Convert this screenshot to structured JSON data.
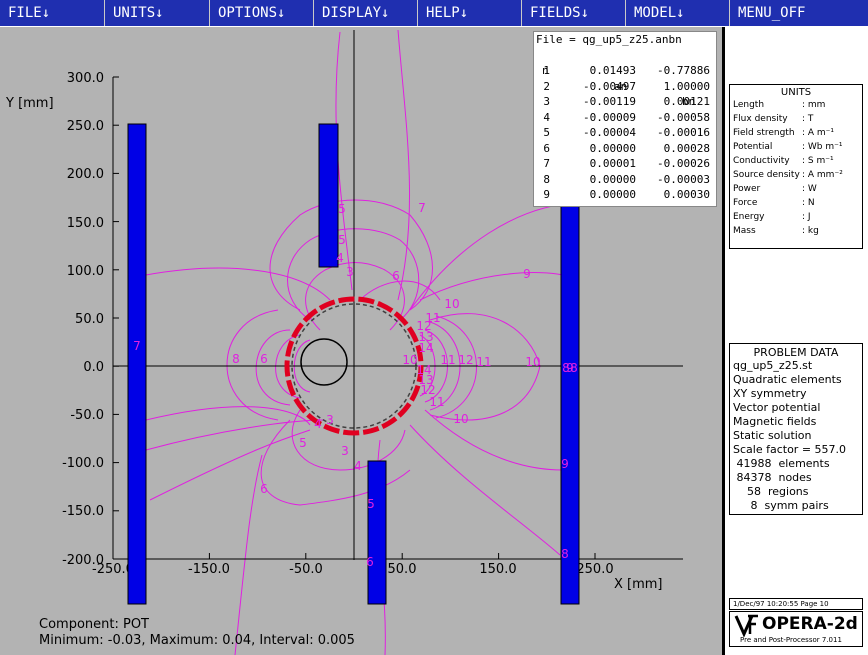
{
  "menu": [
    {
      "label": "FILE↓"
    },
    {
      "label": "UNITS↓"
    },
    {
      "label": "OPTIONS↓"
    },
    {
      "label": "DISPLAY↓"
    },
    {
      "label": "HELP↓"
    },
    {
      "label": "FIELDS↓"
    },
    {
      "label": "MODEL↓"
    },
    {
      "label": "MENU_OFF"
    }
  ],
  "plot": {
    "y_axis_label": "Y [mm]",
    "x_axis_label": "X [mm]",
    "y_ticks": [
      "300.0",
      "250.0",
      "200.0",
      "150.0",
      "100.0",
      "50.0",
      "0.0",
      "-50.0",
      "-100.0",
      "-150.0",
      "-200.0"
    ],
    "x_ticks": [
      "-250.0",
      "-150.0",
      "-50.0",
      "50.0",
      "150.0",
      "250.0"
    ],
    "contour_labels": [
      "7",
      "5",
      "5",
      "4",
      "3",
      "6",
      "7",
      "9",
      "10",
      "11",
      "12",
      "13",
      "14",
      "8",
      "6",
      "10",
      "11",
      "12",
      "11",
      "10",
      "9",
      "10",
      "11",
      "12",
      "13",
      "14",
      "3",
      "4",
      "5",
      "6",
      "6",
      "5",
      "7",
      "9",
      "8",
      "8",
      "3",
      "4",
      "8"
    ],
    "colors": {
      "background": "#b3b3b3",
      "contour": "#e020e0",
      "conductor": "#0000e6",
      "coil": "#e00020"
    }
  },
  "harmonics": {
    "file_line": "File = qg_up5_z25.anbn",
    "headers": [
      "n",
      "an",
      "bn"
    ],
    "rows": [
      {
        "n": "1",
        "an": "0.01493",
        "bn": "-0.77886"
      },
      {
        "n": "2",
        "an": "-0.00497",
        "bn": "1.00000"
      },
      {
        "n": "3",
        "an": "-0.00119",
        "bn": "0.00121"
      },
      {
        "n": "4",
        "an": "-0.00009",
        "bn": "-0.00058"
      },
      {
        "n": "5",
        "an": "-0.00004",
        "bn": "-0.00016"
      },
      {
        "n": "6",
        "an": "0.00000",
        "bn": "0.00028"
      },
      {
        "n": "7",
        "an": "0.00001",
        "bn": "-0.00026"
      },
      {
        "n": "8",
        "an": "0.00000",
        "bn": "-0.00003"
      },
      {
        "n": "9",
        "an": "0.00000",
        "bn": "0.00030"
      }
    ]
  },
  "component_text": "Component: POT",
  "minmax_text": "Minimum: -0.03,  Maximum: 0.04,  Interval: 0.005",
  "units": {
    "title": "UNITS",
    "rows": [
      {
        "name": "Length",
        "value": ": mm"
      },
      {
        "name": "Flux density",
        "value": ": T"
      },
      {
        "name": "Field strength",
        "value": ": A m⁻¹"
      },
      {
        "name": "Potential",
        "value": ": Wb m⁻¹"
      },
      {
        "name": "Conductivity",
        "value": ": S m⁻¹"
      },
      {
        "name": "Source density",
        "value": ": A mm⁻²"
      },
      {
        "name": "Power",
        "value": ": W"
      },
      {
        "name": "Force",
        "value": ": N"
      },
      {
        "name": "Energy",
        "value": ": J"
      },
      {
        "name": "Mass",
        "value": ": kg"
      }
    ]
  },
  "problem_data": {
    "title": "PROBLEM DATA",
    "lines": [
      "qg_up5_z25.st",
      "Quadratic elements",
      "XY symmetry",
      "Vector potential",
      "Magnetic fields",
      "Static solution",
      "Scale factor = 557.0",
      " 41988  elements",
      " 84378  nodes",
      "    58  regions",
      "     8  symm pairs"
    ]
  },
  "footer_date": "1/Dec/97 10:20:55 Page 10",
  "logo": {
    "vf": "VF",
    "name": "OPERA-2d",
    "sub": "Pre and Post-Processor 7.011"
  }
}
